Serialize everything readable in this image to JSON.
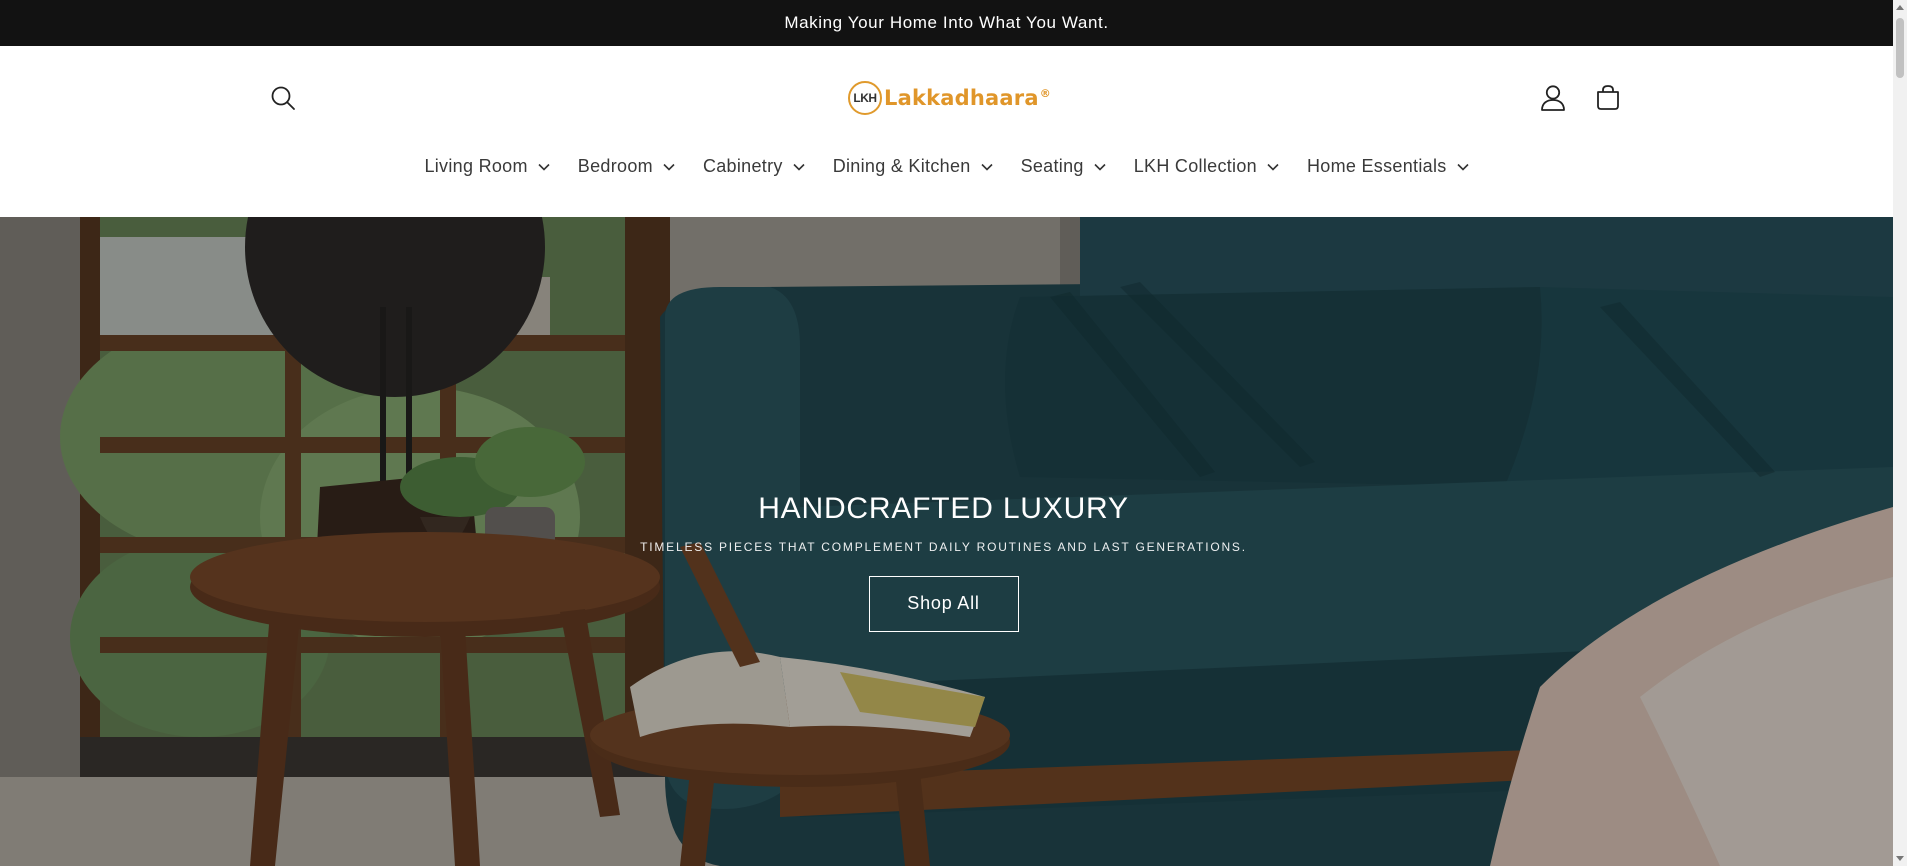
{
  "announcement": {
    "text": "Making Your Home Into What You Want."
  },
  "header": {
    "logo": {
      "mark": "LKH",
      "name": "Lakkadhaara",
      "registered": "®",
      "brand_color": "#e0962a"
    },
    "icons": {
      "search": "search-icon",
      "account": "account-icon",
      "cart": "cart-icon"
    },
    "nav": [
      {
        "label": "Living Room"
      },
      {
        "label": "Bedroom"
      },
      {
        "label": "Cabinetry"
      },
      {
        "label": "Dining & Kitchen"
      },
      {
        "label": "Seating"
      },
      {
        "label": "LKH Collection"
      },
      {
        "label": "Home Essentials"
      }
    ]
  },
  "hero": {
    "title": "HANDCRAFTED LUXURY",
    "subtitle": "TIMELESS PIECES THAT COMPLEMENT DAILY ROUTINES AND LAST GENERATIONS.",
    "button_label": "Shop All"
  },
  "colors": {
    "announcement_bg": "#121212",
    "text_dark": "#3a3a3a",
    "sofa_teal": "#1f4a52"
  }
}
